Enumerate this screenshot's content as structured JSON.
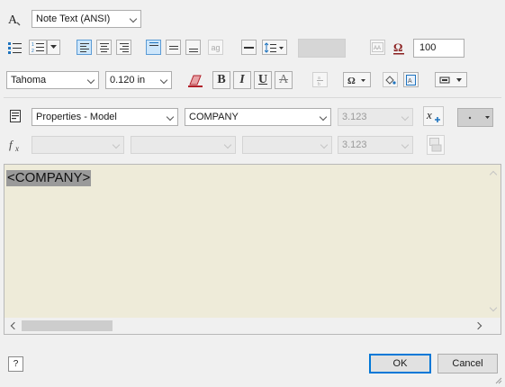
{
  "header": {
    "style_dropdown": "Note Text (ANSI)",
    "zoom_value": "100"
  },
  "format": {
    "font_family": "Tahoma",
    "font_size": "0.120 in",
    "bold_label": "B",
    "italic_label": "I",
    "underline_label": "U",
    "strike_label": "A"
  },
  "parameters": {
    "type_dropdown": "Properties - Model",
    "property_dropdown": "COMPANY",
    "precision_dropdown": "3.123",
    "precision_dropdown_2": "3.123"
  },
  "editor": {
    "content": "<COMPANY>",
    "background_color": "#eeebd9",
    "highlight_color": "#9a9a9a"
  },
  "footer": {
    "ok_label": "OK",
    "cancel_label": "Cancel",
    "help_icon": "help-icon"
  },
  "colors": {
    "selected_button": "#cde6fb",
    "accent": "#0078d7"
  }
}
